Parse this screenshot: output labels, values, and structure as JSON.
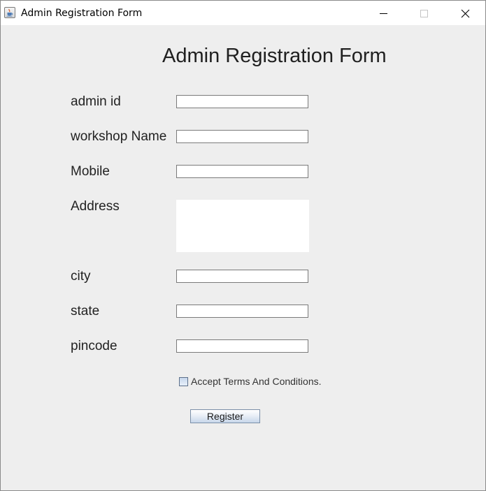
{
  "window": {
    "title": "Admin Registration Form",
    "icon": "java-cup-icon",
    "controls": {
      "minimize": "minimize-icon",
      "maximize": "maximize-icon",
      "close": "close-icon"
    }
  },
  "form": {
    "title": "Admin Registration Form",
    "fields": {
      "admin_id": {
        "label": "admin id",
        "value": ""
      },
      "workshop_name": {
        "label": "workshop Name",
        "value": ""
      },
      "mobile": {
        "label": "Mobile",
        "value": ""
      },
      "address": {
        "label": "Address",
        "value": ""
      },
      "city": {
        "label": "city",
        "value": ""
      },
      "state": {
        "label": "state",
        "value": ""
      },
      "pincode": {
        "label": "pincode",
        "value": ""
      }
    },
    "terms": {
      "label": "Accept Terms And Conditions.",
      "checked": false
    },
    "register_label": "Register"
  }
}
